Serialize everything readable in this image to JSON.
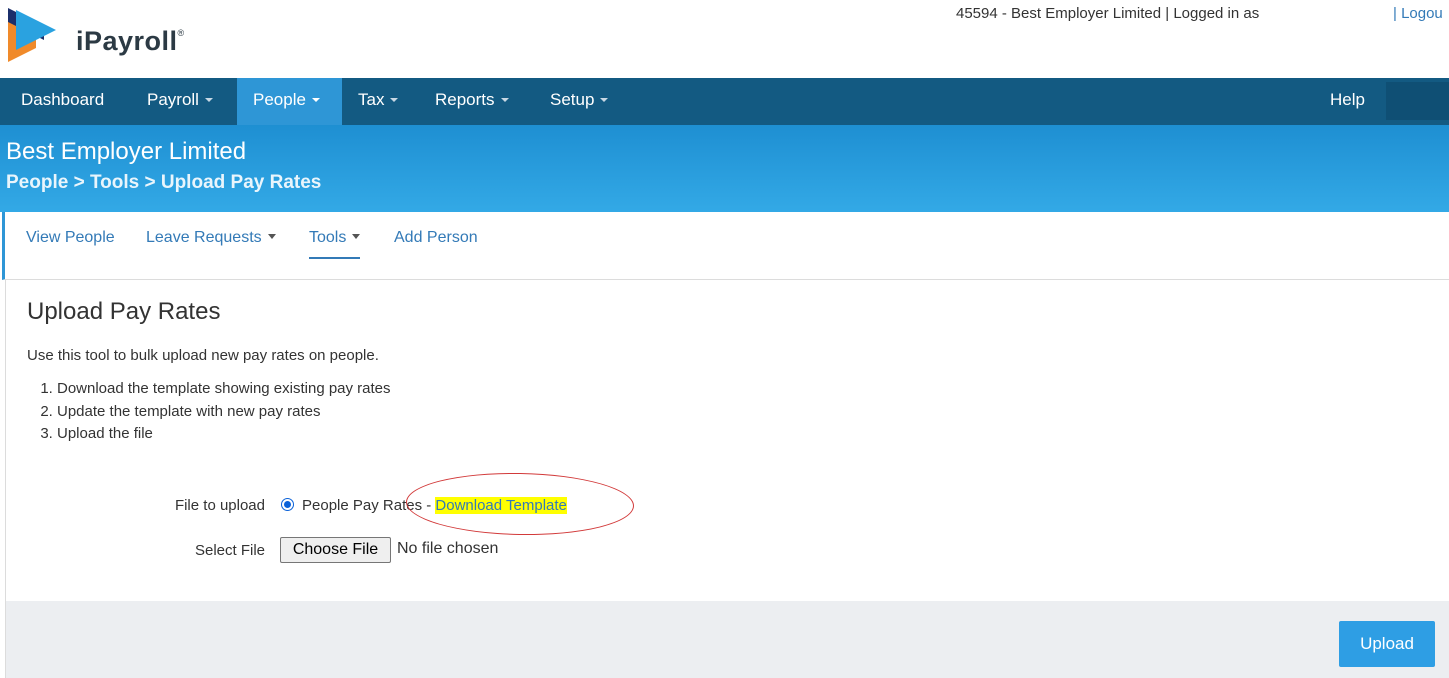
{
  "header": {
    "brand": "iPayroll",
    "account_text": "45594 - Best Employer Limited | Logged in as",
    "logout_label": "| Logou"
  },
  "nav": {
    "items": [
      {
        "label": "Dashboard"
      },
      {
        "label": "Payroll"
      },
      {
        "label": "People"
      },
      {
        "label": "Tax"
      },
      {
        "label": "Reports"
      },
      {
        "label": "Setup"
      }
    ],
    "help_label": "Help"
  },
  "title_band": {
    "company": "Best Employer Limited",
    "breadcrumb": "People > Tools > Upload Pay Rates"
  },
  "subnav": {
    "items": [
      {
        "label": "View People"
      },
      {
        "label": "Leave Requests"
      },
      {
        "label": "Tools"
      },
      {
        "label": "Add Person"
      }
    ]
  },
  "panel": {
    "title": "Upload Pay Rates",
    "intro": "Use this tool to bulk upload new pay rates on people.",
    "steps": [
      "Download the template showing existing pay rates",
      "Update the template with new pay rates",
      "Upload the file"
    ],
    "file_to_upload_label": "File to upload",
    "radio_option": "People Pay Rates - ",
    "download_link": "Download Template",
    "select_file_label": "Select File",
    "choose_file_label": "Choose File",
    "no_file_text": "No file chosen",
    "upload_label": "Upload"
  },
  "colors": {
    "nav_bg": "#135a82",
    "nav_active": "#2e96d6",
    "link": "#337ab7",
    "highlight": "#ffff00",
    "annotation": "#d23a3a",
    "upload_button": "#2e9ee4"
  }
}
